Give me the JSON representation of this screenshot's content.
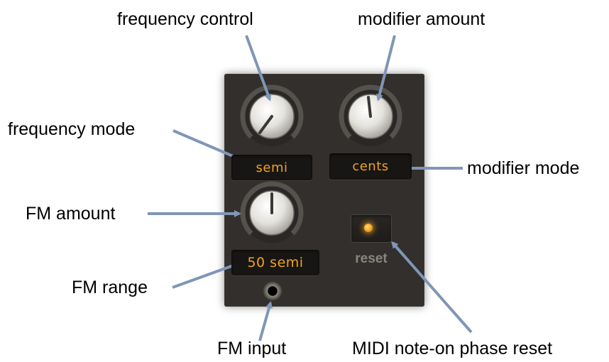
{
  "callouts": {
    "frequency_control": "frequency control",
    "modifier_amount": "modifier amount",
    "frequency_mode": "frequency mode",
    "modifier_mode": "modifier mode",
    "fm_amount": "FM amount",
    "fm_range": "FM range",
    "fm_input": "FM input",
    "midi_reset": "MIDI note-on phase reset"
  },
  "panel": {
    "frequency_mode_display": "semi",
    "modifier_mode_display": "cents",
    "fm_range_display": "50 semi",
    "reset_label": "reset"
  },
  "colors": {
    "arrow": "#7f96b6",
    "display_text": "#f4a11b",
    "panel_bg": "#322f2c"
  }
}
